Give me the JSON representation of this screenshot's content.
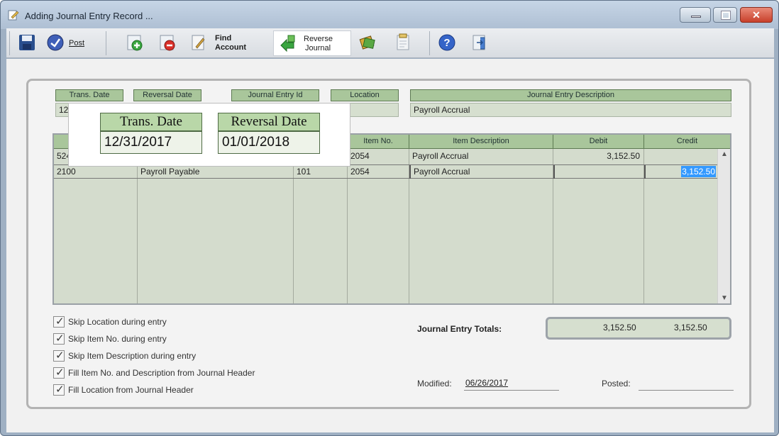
{
  "window": {
    "title": "Adding Journal Entry Record ...",
    "min_icon": "minimize-icon",
    "max_icon": "maximize-icon",
    "close_glyph": "✕"
  },
  "toolbar": {
    "post_label": "Post",
    "find_label_1": "Find",
    "find_label_2": "Account",
    "reverse_label_1": "Reverse",
    "reverse_label_2": "Journal"
  },
  "header": {
    "trans_date_label": "Trans. Date",
    "trans_date_value": "12/",
    "reversal_date_label": "Reversal Date",
    "journal_entry_id_label": "Journal Entry Id",
    "location_label": "Location",
    "description_label": "Journal Entry Description",
    "description_value": "Payroll Accrual"
  },
  "grid": {
    "columns": [
      "",
      "",
      "",
      "Item No.",
      "Item Description",
      "Debit",
      "Credit"
    ],
    "rows": [
      {
        "account": "524",
        "name": "",
        "loc": "",
        "item_no": "2054",
        "item_desc": "Payroll Accrual",
        "debit": "3,152.50",
        "credit": ""
      },
      {
        "account": "2100",
        "name": "Payroll Payable",
        "loc": "101",
        "item_no": "2054",
        "item_desc": "Payroll Accrual",
        "debit": "",
        "credit": "3,152.50"
      }
    ]
  },
  "options": [
    "Skip Location during entry",
    "Skip Item No. during entry",
    "Skip Item Description during entry",
    "Fill Item No. and Description from Journal Header",
    "Fill Location from Journal Header"
  ],
  "totals": {
    "label": "Journal Entry Totals:",
    "debit": "3,152.50",
    "credit": "3,152.50"
  },
  "footer": {
    "modified_label": "Modified:",
    "modified_value": "06/26/2017",
    "posted_label": "Posted:",
    "posted_value": ""
  },
  "callout": {
    "trans_date_label": "Trans. Date",
    "trans_date_value": "12/31/2017",
    "reversal_date_label": "Reversal Date",
    "reversal_date_value": "01/01/2018"
  },
  "colors": {
    "header_green": "#a9c69b",
    "field_bg": "#d6dfcf",
    "selection_blue": "#3399ff"
  }
}
